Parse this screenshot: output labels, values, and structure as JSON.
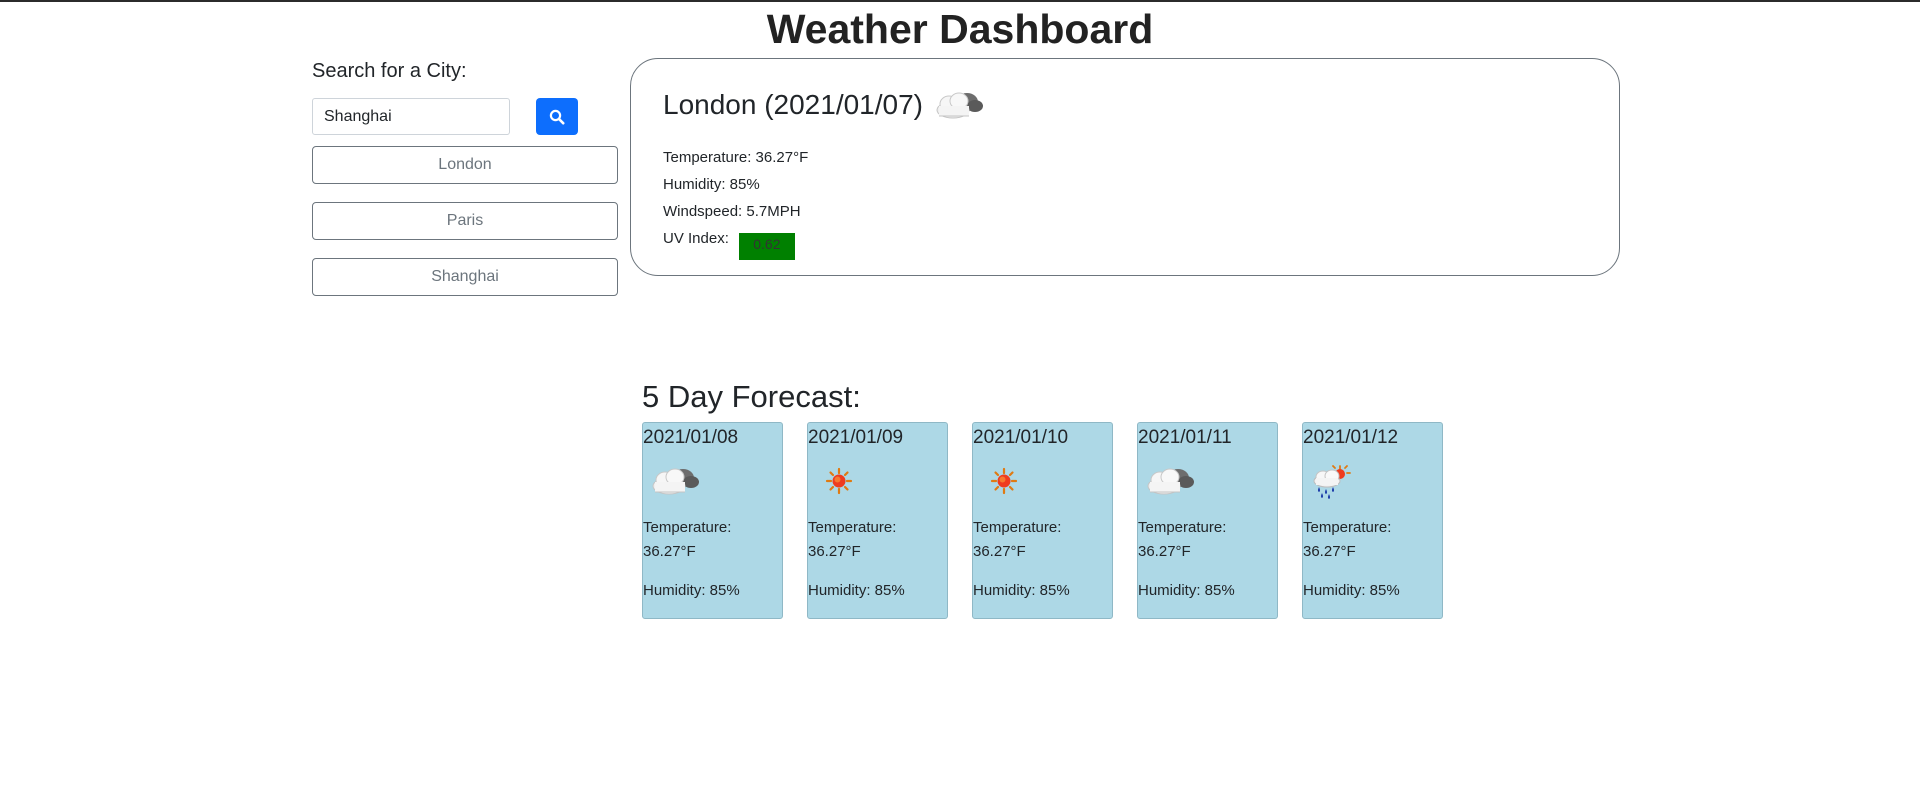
{
  "app": {
    "title": "Weather Dashboard"
  },
  "search": {
    "label": "Search for a City:",
    "value": "Shanghai",
    "button_icon": "search-icon"
  },
  "history": [
    {
      "label": "London"
    },
    {
      "label": "Paris"
    },
    {
      "label": "Shanghai"
    }
  ],
  "current": {
    "heading": "London (2021/01/07)",
    "icon": "cloudy-icon",
    "temperature": "Temperature: 36.27°F",
    "humidity": "Humidity: 85%",
    "windspeed": "Windspeed: 5.7MPH",
    "uv_label": "UV Index:",
    "uv_value": "0.62",
    "uv_color": "#008000"
  },
  "forecast": {
    "title": "5 Day Forecast:",
    "card_color": "#add8e6",
    "days": [
      {
        "date": "2021/01/08",
        "icon": "cloudy-icon",
        "temp_label": "Temperature:",
        "temp": "36.27°F",
        "humidity": "Humidity: 85%"
      },
      {
        "date": "2021/01/09",
        "icon": "sunny-icon",
        "temp_label": "Temperature:",
        "temp": "36.27°F",
        "humidity": "Humidity: 85%"
      },
      {
        "date": "2021/01/10",
        "icon": "sunny-icon",
        "temp_label": "Temperature:",
        "temp": "36.27°F",
        "humidity": "Humidity: 85%"
      },
      {
        "date": "2021/01/11",
        "icon": "cloudy-icon",
        "temp_label": "Temperature:",
        "temp": "36.27°F",
        "humidity": "Humidity: 85%"
      },
      {
        "date": "2021/01/12",
        "icon": "rain-sun-icon",
        "temp_label": "Temperature:",
        "temp": "36.27°F",
        "humidity": "Humidity: 85%"
      }
    ]
  }
}
